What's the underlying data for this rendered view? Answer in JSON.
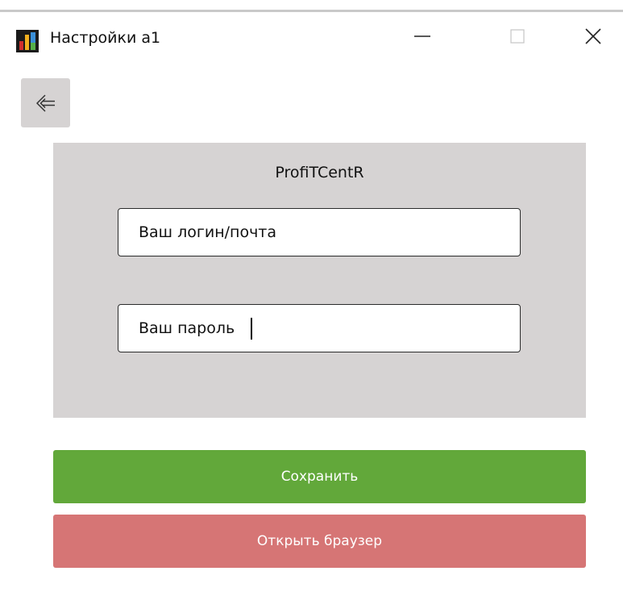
{
  "window": {
    "title": "Настройки a1",
    "icon": "bar-chart-app-icon",
    "controls": [
      "minimize-icon",
      "maximize-icon",
      "close-icon"
    ]
  },
  "back_button": {
    "icon": "back-arrow-icon"
  },
  "panel": {
    "title": "ProfiTCentR",
    "login": {
      "value": "Ваш логин/почта"
    },
    "password": {
      "value": "Ваш пароль"
    }
  },
  "actions": {
    "save_label": "Сохранить",
    "open_browser_label": "Открыть браузер"
  },
  "colors": {
    "panel_bg": "#d6d3d3",
    "save_green": "#62a83a",
    "browser_red": "#d67575"
  }
}
